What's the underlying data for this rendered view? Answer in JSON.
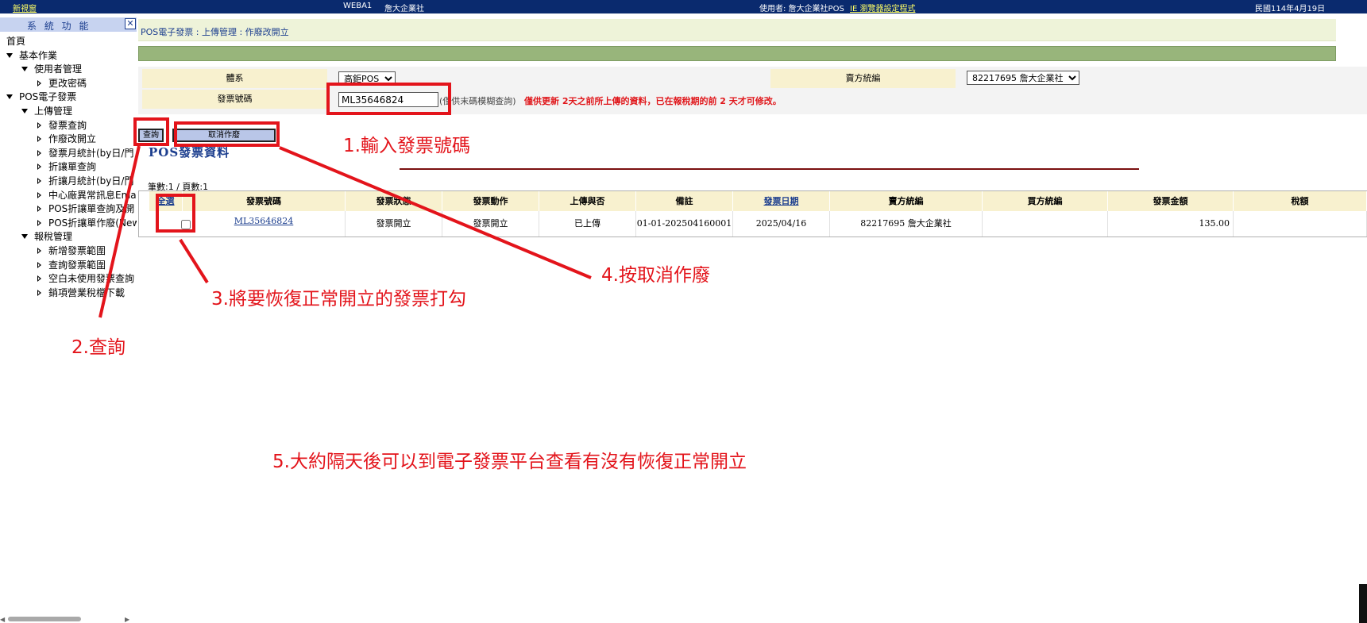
{
  "topbar": {
    "new_window": "新視窗",
    "server": "WEBA1",
    "company": "詹大企業社",
    "user": "使用者: 詹大企業社POS",
    "settings_link": "IE 瀏覽器設定程式",
    "date": "民國114年4月19日"
  },
  "sidebar": {
    "title": "系 統 功 能",
    "close": "✕",
    "items": [
      {
        "label": "首頁",
        "level": 0,
        "arrow": "none"
      },
      {
        "label": "基本作業",
        "level": 0,
        "arrow": "down"
      },
      {
        "label": "使用者管理",
        "level": 1,
        "arrow": "down"
      },
      {
        "label": "更改密碼",
        "level": 2,
        "arrow": "right"
      },
      {
        "label": "POS電子發票",
        "level": 0,
        "arrow": "down"
      },
      {
        "label": "上傳管理",
        "level": 1,
        "arrow": "down"
      },
      {
        "label": "發票查詢",
        "level": 2,
        "arrow": "right"
      },
      {
        "label": "作廢改開立",
        "level": 2,
        "arrow": "right"
      },
      {
        "label": "發票月統計(by日/門",
        "level": 2,
        "arrow": "right"
      },
      {
        "label": "折讓單查詢",
        "level": 2,
        "arrow": "right"
      },
      {
        "label": "折讓月統計(by日/門",
        "level": 2,
        "arrow": "right"
      },
      {
        "label": "中心廠異常訊息Ema",
        "level": 2,
        "arrow": "right"
      },
      {
        "label": "POS折讓單查詢及開",
        "level": 2,
        "arrow": "right"
      },
      {
        "label": "POS折讓單作廢(New",
        "level": 2,
        "arrow": "right"
      },
      {
        "label": "報稅管理",
        "level": 1,
        "arrow": "down"
      },
      {
        "label": "新增發票範圍",
        "level": 2,
        "arrow": "right"
      },
      {
        "label": "查詢發票範圍",
        "level": 2,
        "arrow": "right"
      },
      {
        "label": "空白未使用發票查詢",
        "level": 2,
        "arrow": "right"
      },
      {
        "label": "銷項營業稅檔下載",
        "level": 2,
        "arrow": "right"
      }
    ]
  },
  "main": {
    "breadcrumb": "POS電子發票 : 上傳管理 : 作廢改開立",
    "form": {
      "system_label": "體系",
      "system_value": "高鉅POS",
      "seller_label": "賣方統編",
      "seller_value": "82217695 詹大企業社",
      "invoice_label": "發票號碼",
      "invoice_value": "ML35646824",
      "hint_gray": "(僅供末碼模糊查詢)",
      "hint_red": "僅供更新 2天之前所上傳的資料，已在報稅期的前 2 天才可修改。"
    },
    "buttons": {
      "query": "查詢",
      "cancel_void": "取消作廢"
    },
    "section_title": "POS發票資料",
    "count": "筆數:1 / 頁數:1",
    "table": {
      "headers": [
        "全選",
        "發票號碼",
        "發票狀態",
        "發票動作",
        "上傳與否",
        "備註",
        "發票日期",
        "賣方統編",
        "買方統編",
        "發票金額",
        "稅額"
      ],
      "row": {
        "invoice_no": "ML35646824",
        "status": "發票開立",
        "action": "發票開立",
        "uploaded": "已上傳",
        "note": "01-01-202504160001",
        "date": "2025/04/16",
        "seller": "82217695 詹大企業社",
        "buyer": "",
        "amount": "135.00",
        "tax": ""
      }
    }
  },
  "annotations": {
    "step1": "1.輸入發票號碼",
    "step2": "2.查詢",
    "step3": "3.將要恢復正常開立的發票打勾",
    "step4": "4.按取消作廢",
    "step5": "5.大約隔天後可以到電子發票平台查看有沒有恢復正常開立",
    "color": "#e3141b"
  },
  "icons": {
    "expanded": "triangle-down-icon",
    "collapsed": "triangle-right-icon",
    "close": "close-icon"
  }
}
